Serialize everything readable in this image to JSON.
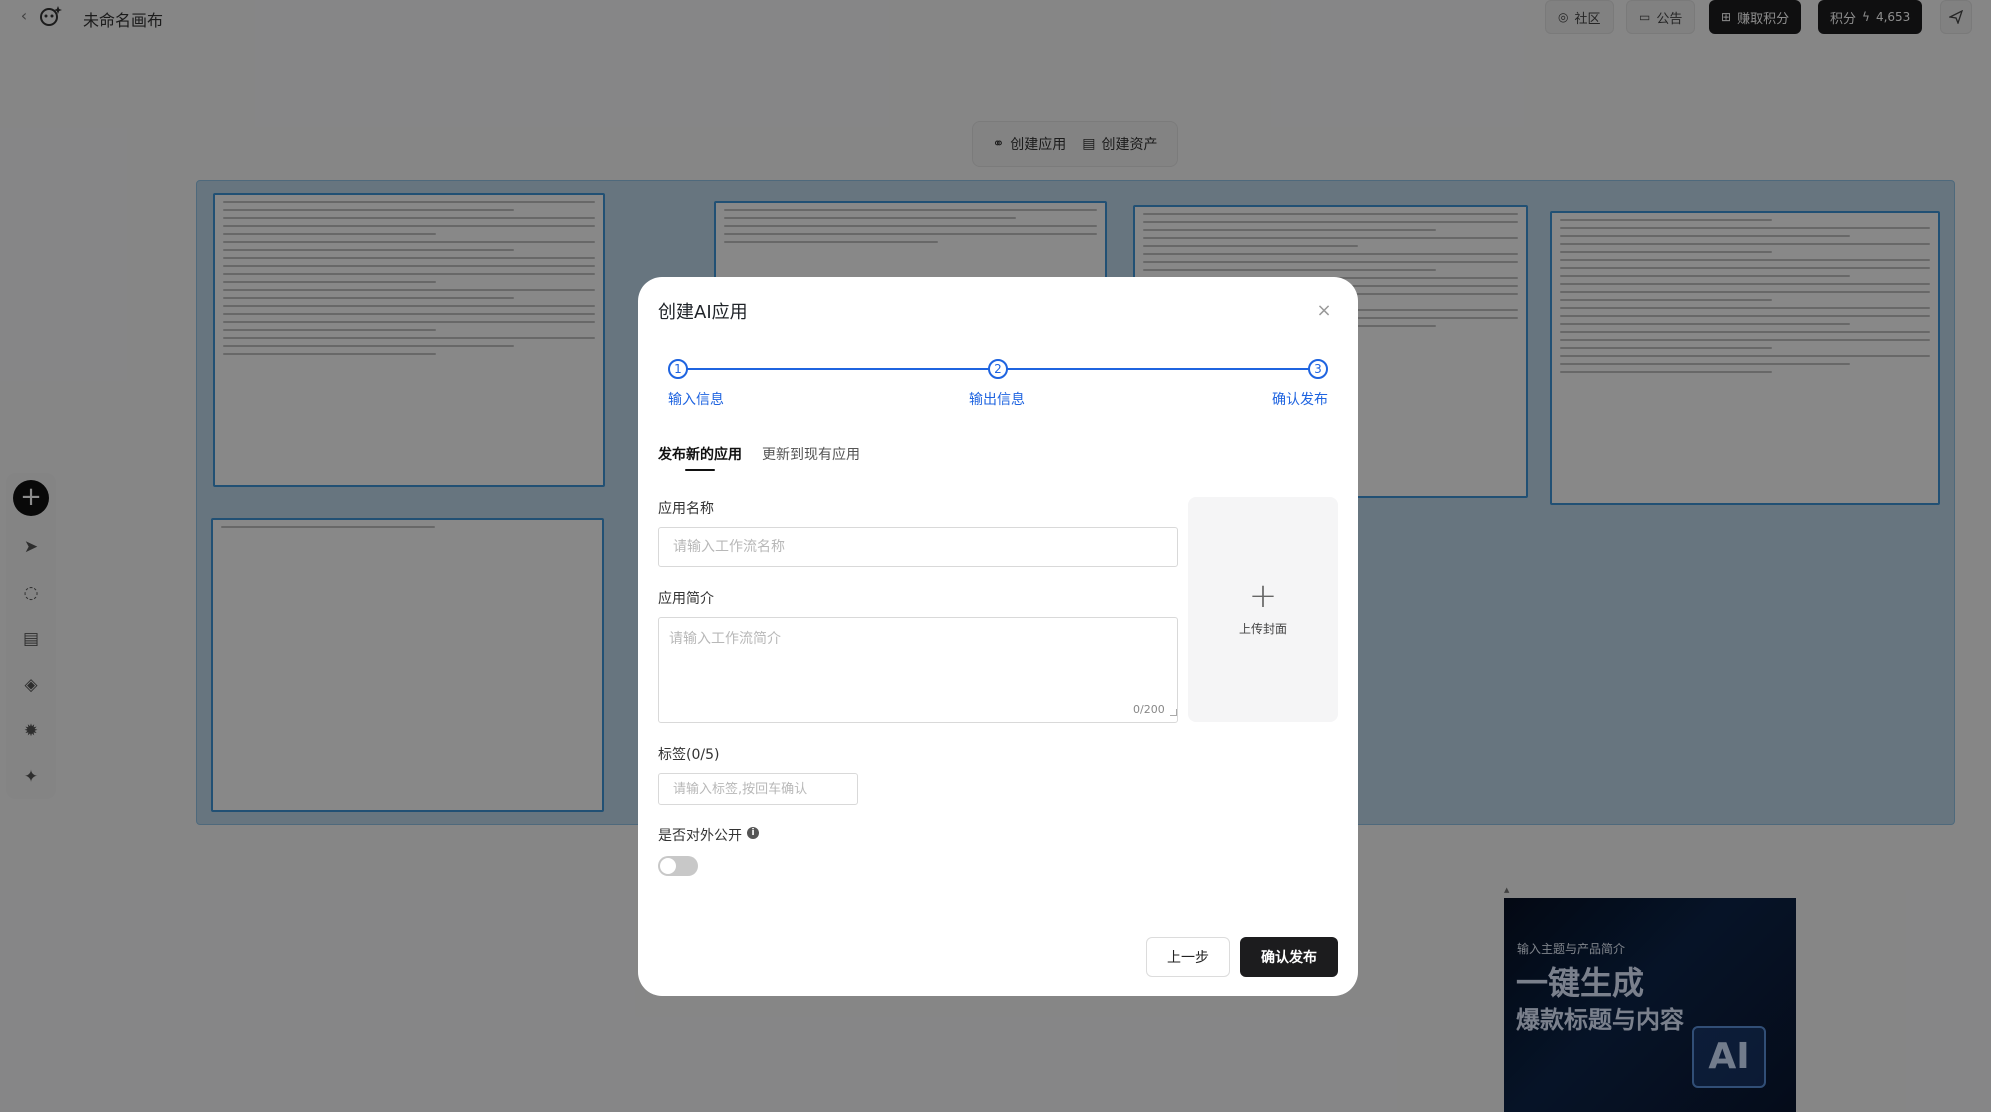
{
  "topbar": {
    "title": "未命名画布",
    "community": "社区",
    "announcement": "公告",
    "earn_points": "赚取积分",
    "points_label": "积分",
    "points_value": "4,653"
  },
  "canvas": {
    "create_app": "创建应用",
    "create_asset": "创建资产",
    "thumbnail": {
      "subtitle": "输入主题与产品简介",
      "headline1": "一键生成",
      "headline2": "爆款标题与内容",
      "ai_badge": "AI"
    }
  },
  "modal": {
    "title": "创建AI应用",
    "steps": [
      {
        "num": "1",
        "label": "输入信息"
      },
      {
        "num": "2",
        "label": "输出信息"
      },
      {
        "num": "3",
        "label": "确认发布"
      }
    ],
    "tabs": {
      "new_app": "发布新的应用",
      "update_app": "更新到现有应用"
    },
    "app_name": {
      "label": "应用名称",
      "placeholder": "请输入工作流名称",
      "value": ""
    },
    "app_intro": {
      "label": "应用简介",
      "placeholder": "请输入工作流简介",
      "value": "",
      "counter": "0/200"
    },
    "cover": {
      "label": "上传封面"
    },
    "tags": {
      "label": "标签(0/5)",
      "placeholder": "请输入标签,按回车确认",
      "value": ""
    },
    "public": {
      "label": "是否对外公开",
      "enabled": false
    },
    "buttons": {
      "prev": "上一步",
      "publish": "确认发布"
    }
  },
  "colors": {
    "accent": "#1f64e0",
    "dark": "#1c1c1e",
    "node_border": "#3c93d3"
  }
}
